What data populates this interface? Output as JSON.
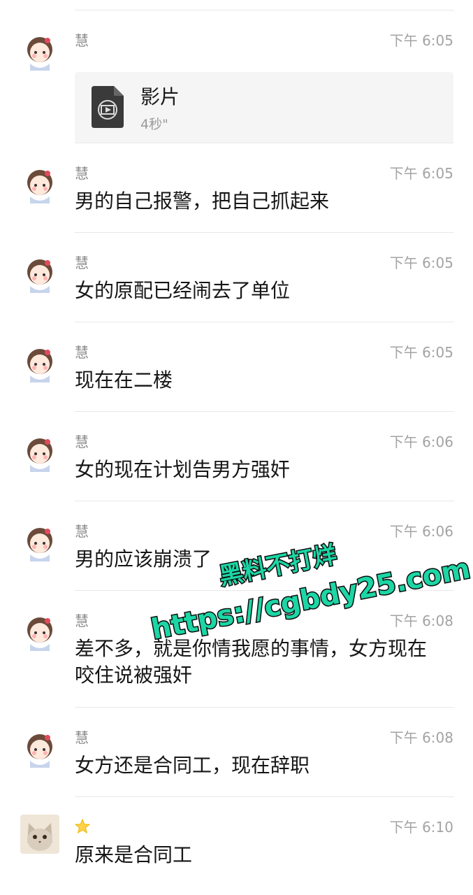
{
  "messages": [
    {
      "name": "慧",
      "time": "下午 6:05",
      "type": "file",
      "file": {
        "title": "影片",
        "sub": "4秒\""
      }
    },
    {
      "name": "慧",
      "time": "下午 6:05",
      "text": "男的自己报警，把自己抓起来"
    },
    {
      "name": "慧",
      "time": "下午 6:05",
      "text": "女的原配已经闹去了单位"
    },
    {
      "name": "慧",
      "time": "下午 6:05",
      "text": "现在在二楼"
    },
    {
      "name": "慧",
      "time": "下午 6:06",
      "text": "女的现在计划告男方强奸"
    },
    {
      "name": "慧",
      "time": "下午 6:06",
      "text": "男的应该崩溃了"
    },
    {
      "name": "慧",
      "time": "下午 6:08",
      "text": "差不多，就是你情我愿的事情，女方现在咬住说被强奸"
    },
    {
      "name": "慧",
      "time": "下午 6:08",
      "text": "女方还是合同工，现在辞职"
    },
    {
      "name": "",
      "time": "下午 6:10",
      "text": "原来是合同工"
    }
  ],
  "watermark": {
    "line1": "黑料不打烊",
    "line2": "https://cgbdy25.com"
  },
  "colors": {
    "watermark_fill": "#1cd6a5",
    "watermark_stroke": "#0b0b0b"
  }
}
